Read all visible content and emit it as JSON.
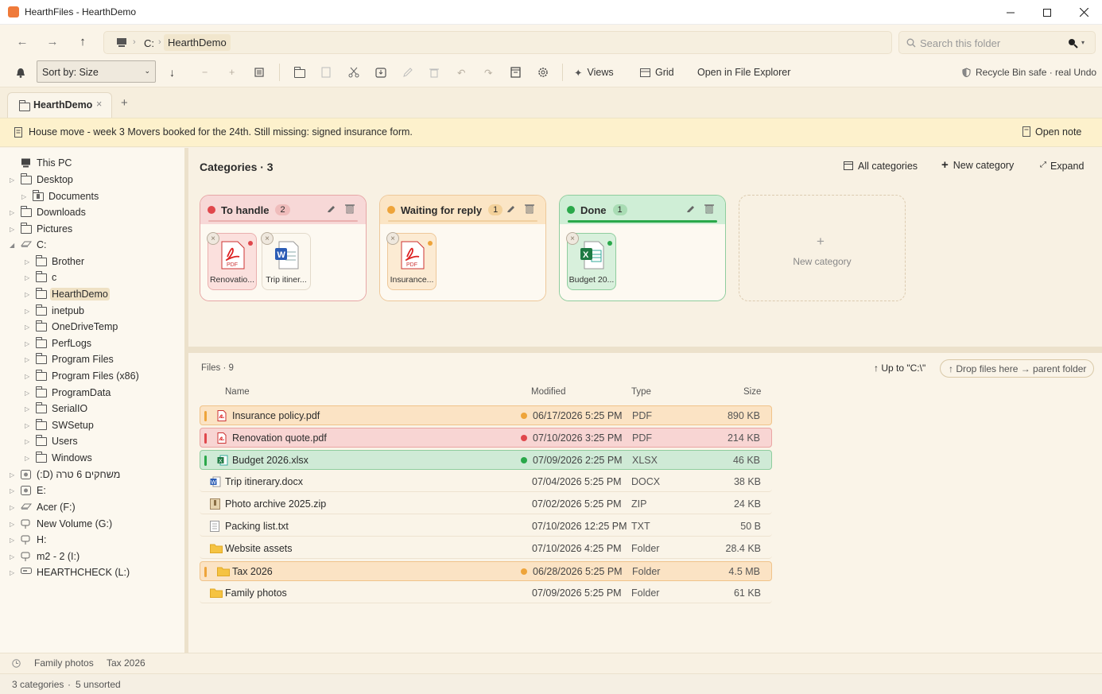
{
  "window": {
    "title": "HearthFiles - HearthDemo"
  },
  "address": {
    "crumbs": [
      "C:",
      "HearthDemo"
    ],
    "search_placeholder": "Search this folder"
  },
  "toolbar": {
    "sort_label": "Sort by: Size",
    "views_label": "Views",
    "grid_label": "Grid",
    "open_explorer_label": "Open in File Explorer",
    "recycle_label": "Recycle Bin safe · real Undo"
  },
  "tabs": [
    {
      "label": "HearthDemo"
    }
  ],
  "note": {
    "text": "House move - week 3 Movers booked for the 24th. Still missing: signed insurance form.",
    "open_label": "Open note"
  },
  "sidebar": {
    "items": [
      {
        "label": "This PC"
      },
      {
        "label": "Desktop"
      },
      {
        "label": "Documents"
      },
      {
        "label": "Downloads"
      },
      {
        "label": "Pictures"
      },
      {
        "label": "C:"
      },
      {
        "label": "Brother"
      },
      {
        "label": "c"
      },
      {
        "label": "HearthDemo"
      },
      {
        "label": "inetpub"
      },
      {
        "label": "OneDriveTemp"
      },
      {
        "label": "PerfLogs"
      },
      {
        "label": "Program Files"
      },
      {
        "label": "Program Files (x86)"
      },
      {
        "label": "ProgramData"
      },
      {
        "label": "SerialIO"
      },
      {
        "label": "SWSetup"
      },
      {
        "label": "Users"
      },
      {
        "label": "Windows"
      },
      {
        "label": "(:D) משחקים 6 טרה"
      },
      {
        "label": "E:"
      },
      {
        "label": "Acer (F:)"
      },
      {
        "label": "New Volume (G:)"
      },
      {
        "label": "H:"
      },
      {
        "label": "m2 - 2 (I:)"
      },
      {
        "label": "HEARTHCHECK (L:)"
      }
    ]
  },
  "categories": {
    "title": "Categories · 3",
    "all_label": "All categories",
    "new_label": "New category",
    "expand_label": "Expand",
    "new_card_label": "New category",
    "cards": [
      {
        "name": "To handle",
        "count": "2",
        "color": "#e0474c",
        "files": [
          {
            "label": "Renovatio..."
          },
          {
            "label": "Trip itiner..."
          }
        ]
      },
      {
        "name": "Waiting for reply",
        "count": "1",
        "color": "#eea43a",
        "files": [
          {
            "label": "Insurance..."
          }
        ]
      },
      {
        "name": "Done",
        "count": "1",
        "color": "#2aa84a",
        "files": [
          {
            "label": "Budget 20..."
          }
        ]
      }
    ]
  },
  "files": {
    "title": "Files · 9",
    "up_label": "Up to \"C:\\\"",
    "drop_label": "Drop files here → parent folder",
    "columns": {
      "name": "Name",
      "modified": "Modified",
      "type": "Type",
      "size": "Size"
    },
    "rows": [
      {
        "name": "Insurance policy.pdf",
        "modified": "06/17/2026 5:25 PM",
        "type": "PDF",
        "size": "890 KB"
      },
      {
        "name": "Renovation quote.pdf",
        "modified": "07/10/2026 3:25 PM",
        "type": "PDF",
        "size": "214 KB"
      },
      {
        "name": "Budget 2026.xlsx",
        "modified": "07/09/2026 2:25 PM",
        "type": "XLSX",
        "size": "46 KB"
      },
      {
        "name": "Trip itinerary.docx",
        "modified": "07/04/2026 5:25 PM",
        "type": "DOCX",
        "size": "38 KB"
      },
      {
        "name": "Photo archive 2025.zip",
        "modified": "07/02/2026 5:25 PM",
        "type": "ZIP",
        "size": "24 KB"
      },
      {
        "name": "Packing list.txt",
        "modified": "07/10/2026 12:25 PM",
        "type": "TXT",
        "size": "50 B"
      },
      {
        "name": "Website assets",
        "modified": "07/10/2026 4:25 PM",
        "type": "Folder",
        "size": "28.4 KB"
      },
      {
        "name": "Tax 2026",
        "modified": "06/28/2026 5:25 PM",
        "type": "Folder",
        "size": "4.5 MB"
      },
      {
        "name": "Family photos",
        "modified": "07/09/2026 5:25 PM",
        "type": "Folder",
        "size": "61 KB"
      }
    ]
  },
  "recent": [
    "Family photos",
    "Tax 2026"
  ],
  "status": {
    "categories": "3 categories",
    "unsorted": "5 unsorted"
  }
}
